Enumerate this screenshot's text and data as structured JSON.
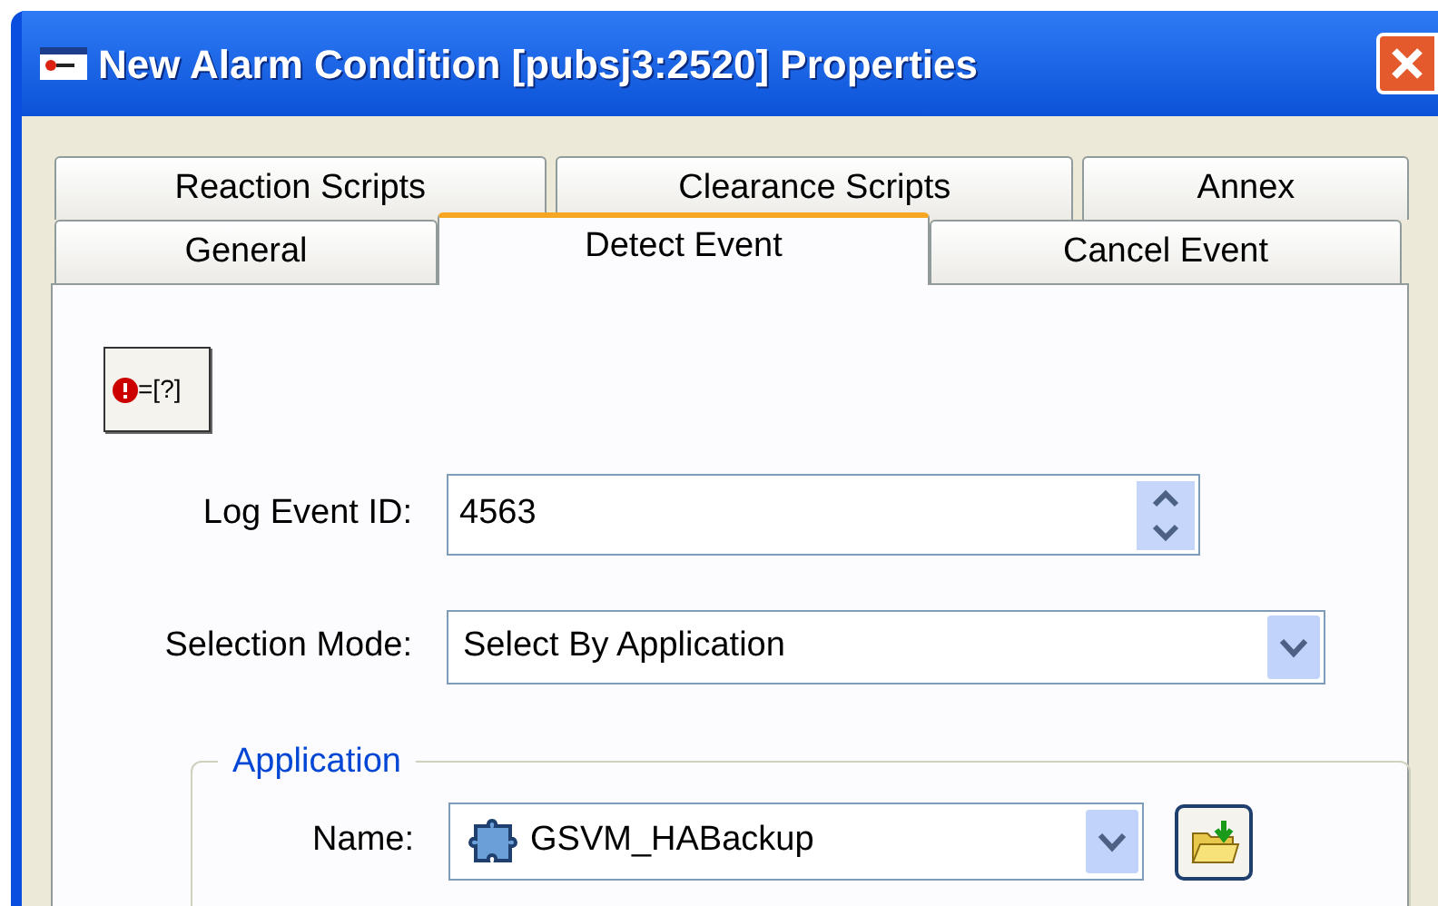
{
  "window": {
    "title": "New Alarm Condition [pubsj3:2520] Properties"
  },
  "tab_rows": [
    [
      {
        "label": "Reaction Scripts",
        "selected": false
      },
      {
        "label": "Clearance Scripts",
        "selected": false
      },
      {
        "label": "Annex",
        "selected": false
      }
    ],
    [
      {
        "label": "General",
        "selected": false
      },
      {
        "label": "Detect Event",
        "selected": true
      },
      {
        "label": "Cancel Event",
        "selected": false
      }
    ]
  ],
  "condition_button": {
    "label": "=[?]"
  },
  "log_event_id": {
    "label": "Log Event ID:",
    "value": "4563"
  },
  "selection_mode": {
    "label": "Selection Mode:",
    "value": "Select By Application"
  },
  "application_group": {
    "title": "Application",
    "name": {
      "label": "Name:",
      "value": "GSVM_HABackup"
    }
  }
}
